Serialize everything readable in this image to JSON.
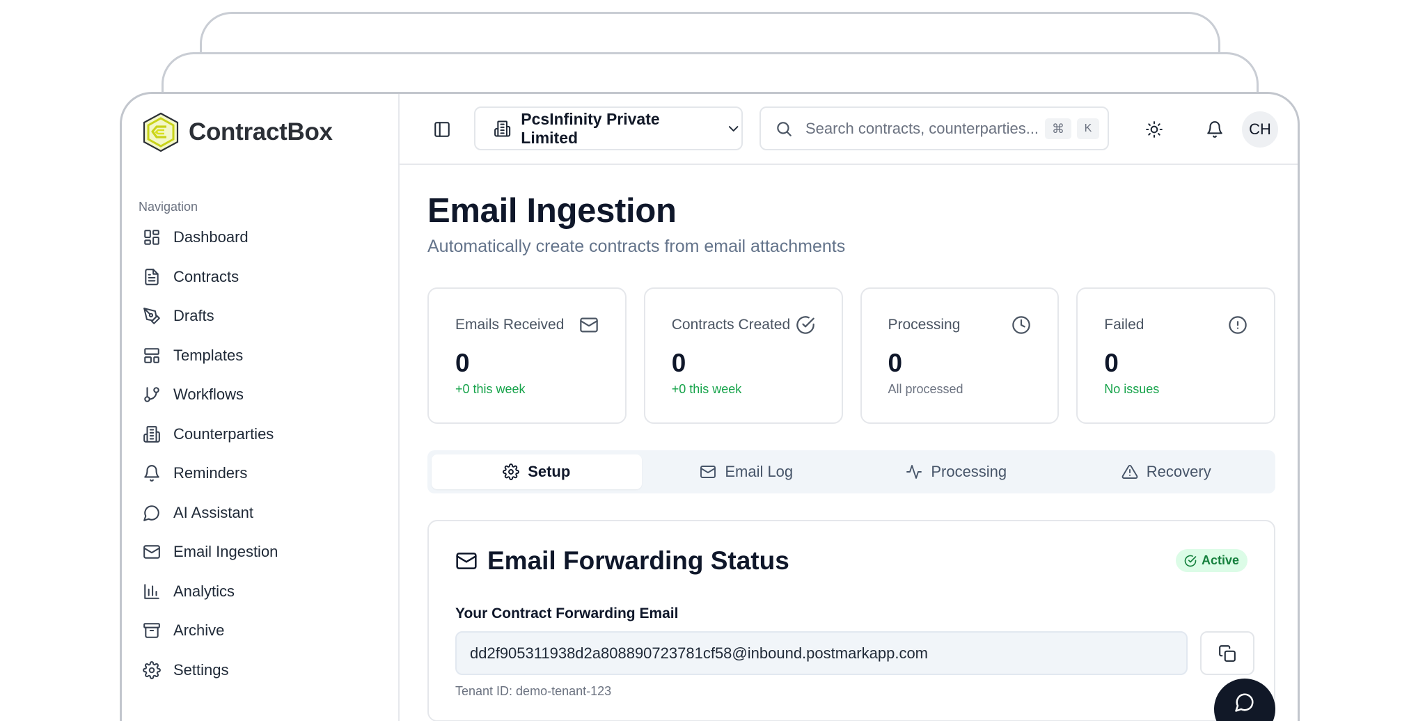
{
  "brand": {
    "name": "ContractBox"
  },
  "sidebar": {
    "heading": "Navigation",
    "items": [
      {
        "label": "Dashboard",
        "icon": "dashboard-icon"
      },
      {
        "label": "Contracts",
        "icon": "file-text-icon"
      },
      {
        "label": "Drafts",
        "icon": "pen-tool-icon"
      },
      {
        "label": "Templates",
        "icon": "template-icon"
      },
      {
        "label": "Workflows",
        "icon": "git-branch-icon"
      },
      {
        "label": "Counterparties",
        "icon": "building-icon"
      },
      {
        "label": "Reminders",
        "icon": "bell-icon"
      },
      {
        "label": "AI Assistant",
        "icon": "message-circle-icon"
      },
      {
        "label": "Email Ingestion",
        "icon": "mail-icon"
      },
      {
        "label": "Analytics",
        "icon": "bar-chart-icon"
      },
      {
        "label": "Archive",
        "icon": "archive-icon"
      },
      {
        "label": "Settings",
        "icon": "gear-icon"
      }
    ]
  },
  "header": {
    "org": "PcsInfinity Private Limited",
    "search_placeholder": "Search contracts, counterparties...",
    "kbd_cmd": "⌘",
    "kbd_key": "K",
    "avatar": "CH"
  },
  "page": {
    "title": "Email Ingestion",
    "subtitle": "Automatically create contracts from email attachments"
  },
  "stats": [
    {
      "label": "Emails Received",
      "value": "0",
      "sub": "+0 this week",
      "sub_color": "green",
      "icon": "mail-icon"
    },
    {
      "label": "Contracts Created",
      "value": "0",
      "sub": "+0 this week",
      "sub_color": "green",
      "icon": "check-circle-icon"
    },
    {
      "label": "Processing",
      "value": "0",
      "sub": "All processed",
      "sub_color": "muted",
      "icon": "clock-icon"
    },
    {
      "label": "Failed",
      "value": "0",
      "sub": "No issues",
      "sub_color": "green",
      "icon": "alert-circle-icon"
    }
  ],
  "tabs": [
    {
      "label": "Setup",
      "icon": "gear-icon",
      "active": true
    },
    {
      "label": "Email Log",
      "icon": "mail-icon",
      "active": false
    },
    {
      "label": "Processing",
      "icon": "activity-icon",
      "active": false
    },
    {
      "label": "Recovery",
      "icon": "alert-triangle-icon",
      "active": false
    }
  ],
  "forwarding": {
    "title": "Email Forwarding Status",
    "status": "Active",
    "field_label": "Your Contract Forwarding Email",
    "email": "dd2f905311938d2a808890723781cf58@inbound.postmarkapp.com",
    "tenant": "Tenant ID: demo-tenant-123"
  },
  "colors": {
    "accent_green": "#16a34a",
    "badge_bg": "#dcfce7",
    "logo_yellow": "#d9e021",
    "fab_bg": "#111827"
  }
}
